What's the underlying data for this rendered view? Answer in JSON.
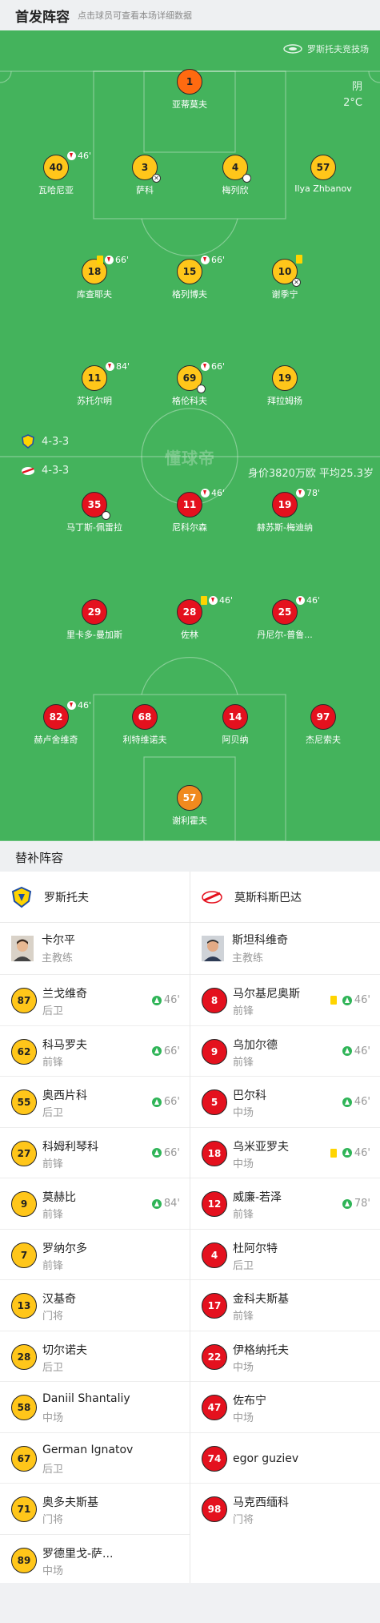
{
  "header": {
    "title": "首发阵容",
    "subtitle": "点击球员可查看本场详细数据"
  },
  "pitch": {
    "stadium": "罗斯托夫竞技场",
    "weather": "阴",
    "temperature": "2°C",
    "watermark": "懂球帝",
    "home_formation": "4-3-3",
    "away_formation": "4-3-3",
    "away_value": "身价3820万欧 平均25.3岁"
  },
  "home_players": [
    {
      "num": "1",
      "name": "亚蒂莫夫",
      "gk": true,
      "events": ""
    },
    {
      "num": "40",
      "name": "瓦哈尼亚",
      "events": "46'"
    },
    {
      "num": "3",
      "name": "萨科",
      "events": ""
    },
    {
      "num": "4",
      "name": "梅列欣",
      "events": ""
    },
    {
      "num": "57",
      "name": "Ilya Zhbanov",
      "events": ""
    },
    {
      "num": "18",
      "name": "库查耶夫",
      "events": "66'"
    },
    {
      "num": "15",
      "name": "格列博夫",
      "events": "66'"
    },
    {
      "num": "10",
      "name": "谢季宁",
      "events": ""
    },
    {
      "num": "11",
      "name": "苏托尔明",
      "events": "84'"
    },
    {
      "num": "69",
      "name": "格伦科夫",
      "events": "66'"
    },
    {
      "num": "19",
      "name": "拜拉姆扬",
      "events": ""
    }
  ],
  "away_players": [
    {
      "num": "35",
      "name": "马丁斯-佩雷拉",
      "events": ""
    },
    {
      "num": "11",
      "name": "尼科尔森",
      "events": "46'"
    },
    {
      "num": "19",
      "name": "赫苏斯-梅迪纳",
      "events": "78'"
    },
    {
      "num": "29",
      "name": "里卡多-曼加斯",
      "events": ""
    },
    {
      "num": "28",
      "name": "佐林",
      "events": "46'"
    },
    {
      "num": "25",
      "name": "丹尼尔-普鲁...",
      "events": "46'"
    },
    {
      "num": "82",
      "name": "赫卢舍维奇",
      "events": "46'"
    },
    {
      "num": "68",
      "name": "利特维诺夫",
      "events": ""
    },
    {
      "num": "14",
      "name": "阿贝纳",
      "events": ""
    },
    {
      "num": "97",
      "name": "杰尼索夫",
      "events": ""
    },
    {
      "num": "57",
      "name": "谢利霍夫",
      "gk": true,
      "events": ""
    }
  ],
  "subs": {
    "title": "替补阵容",
    "home_team": "罗斯托夫",
    "away_team": "莫斯科斯巴达",
    "home_coach": {
      "name": "卡尔平",
      "role": "主教练"
    },
    "away_coach": {
      "name": "斯坦科维奇",
      "role": "主教练"
    },
    "home": [
      {
        "num": "87",
        "name": "兰戈维奇",
        "pos": "后卫",
        "time": "46'"
      },
      {
        "num": "62",
        "name": "科马罗夫",
        "pos": "前锋",
        "time": "66'"
      },
      {
        "num": "55",
        "name": "奥西片科",
        "pos": "后卫",
        "time": "66'"
      },
      {
        "num": "27",
        "name": "科姆利琴科",
        "pos": "前锋",
        "time": "66'"
      },
      {
        "num": "9",
        "name": "莫赫比",
        "pos": "前锋",
        "time": "84'"
      },
      {
        "num": "7",
        "name": "罗纳尔多",
        "pos": "前锋",
        "time": ""
      },
      {
        "num": "13",
        "name": "汉基奇",
        "pos": "门将",
        "time": ""
      },
      {
        "num": "28",
        "name": "切尔诺夫",
        "pos": "后卫",
        "time": ""
      },
      {
        "num": "58",
        "name": "Daniil Shantaliy",
        "pos": "中场",
        "time": ""
      },
      {
        "num": "67",
        "name": "German Ignatov",
        "pos": "后卫",
        "time": ""
      },
      {
        "num": "71",
        "name": "奥多夫斯基",
        "pos": "门将",
        "time": ""
      },
      {
        "num": "89",
        "name": "罗德里戈-萨...",
        "pos": "中场",
        "time": ""
      }
    ],
    "away": [
      {
        "num": "8",
        "name": "马尔基尼奥斯",
        "pos": "前锋",
        "time": "46'",
        "yellow": true
      },
      {
        "num": "9",
        "name": "乌加尔德",
        "pos": "前锋",
        "time": "46'"
      },
      {
        "num": "5",
        "name": "巴尔科",
        "pos": "中场",
        "time": "46'"
      },
      {
        "num": "18",
        "name": "乌米亚罗夫",
        "pos": "中场",
        "time": "46'",
        "yellow": true
      },
      {
        "num": "12",
        "name": "威廉-若泽",
        "pos": "前锋",
        "time": "78'"
      },
      {
        "num": "4",
        "name": "杜阿尔特",
        "pos": "后卫",
        "time": ""
      },
      {
        "num": "17",
        "name": "金科夫斯基",
        "pos": "前锋",
        "time": ""
      },
      {
        "num": "22",
        "name": "伊格纳托夫",
        "pos": "中场",
        "time": ""
      },
      {
        "num": "47",
        "name": "佐布宁",
        "pos": "中场",
        "time": ""
      },
      {
        "num": "74",
        "name": "egor guziev",
        "pos": "",
        "time": ""
      },
      {
        "num": "98",
        "name": "马克西缅科",
        "pos": "门将",
        "time": ""
      }
    ]
  }
}
